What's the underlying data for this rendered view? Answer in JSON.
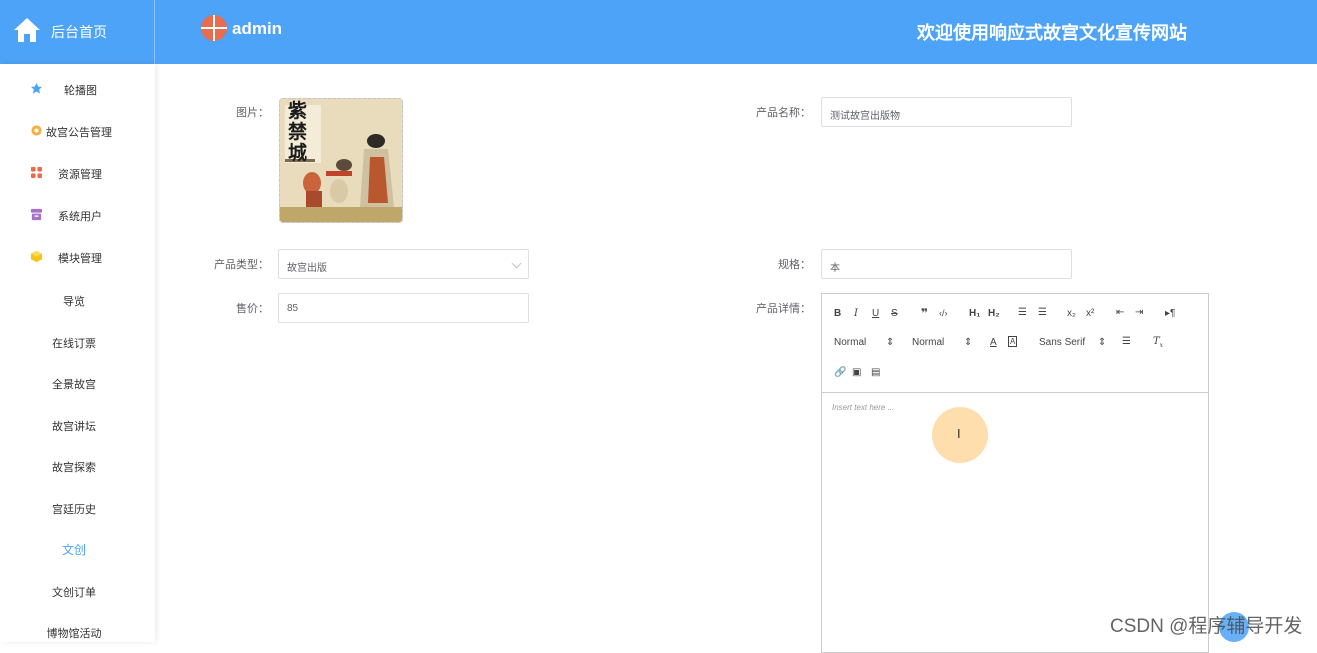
{
  "header": {
    "home_label": "后台首页",
    "user_name": "admin",
    "site_title": "欢迎使用响应式故宫文化宣传网站"
  },
  "sidebar": {
    "items": [
      {
        "label": "轮播图",
        "icon": "star-icon",
        "color": "#4da3f7"
      },
      {
        "label": "故宫公告管理",
        "icon": "gear-icon",
        "color": "#f5b045"
      },
      {
        "label": "资源管理",
        "icon": "grid-icon",
        "color": "#e86c50"
      },
      {
        "label": "系统用户",
        "icon": "user-box-icon",
        "color": "#a472c6"
      },
      {
        "label": "模块管理",
        "icon": "cube-icon",
        "color": "#f5c518"
      }
    ],
    "subitems": [
      {
        "label": "导览"
      },
      {
        "label": "在线订票"
      },
      {
        "label": "全景故宫"
      },
      {
        "label": "故宫讲坛"
      },
      {
        "label": "故宫探索"
      },
      {
        "label": "宫廷历史"
      },
      {
        "label": "文创",
        "active": true
      },
      {
        "label": "文创订单"
      },
      {
        "label": "博物馆活动"
      }
    ]
  },
  "form": {
    "image_label": "图片：",
    "image_text": "紫禁城",
    "name_label": "产品名称：",
    "name_value": "测试故宫出版物",
    "type_label": "产品类型：",
    "type_value": "故宫出版",
    "spec_label": "规格：",
    "spec_value": "本",
    "price_label": "售价：",
    "price_value": "85",
    "detail_label": "产品详情："
  },
  "editor": {
    "header_select": "Normal",
    "size_select": "Normal",
    "font_select": "Sans Serif",
    "placeholder": "Insert text here ..."
  },
  "cursor_glyph": "I",
  "watermark": "CSDN @程序辅导开发"
}
